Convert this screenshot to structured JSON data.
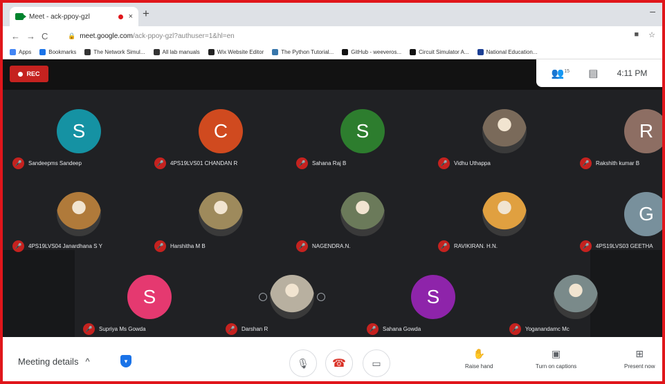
{
  "browser": {
    "tab_title": "Meet - ack-ppoy-gzl",
    "tab_close": "×",
    "new_tab": "+",
    "minimize": "–",
    "nav_back": "←",
    "nav_forward": "→",
    "nav_reload": "C",
    "url_host": "meet.google.com",
    "url_rest": "/ack-ppoy-gzl?authuser=1&hl=en",
    "bookmarks": [
      {
        "label": "Apps",
        "color": "#4285f4"
      },
      {
        "label": "Bookmarks",
        "color": "#1a73e8"
      },
      {
        "label": "The Network Simul...",
        "color": "#333333"
      },
      {
        "label": "All lab manuals",
        "color": "#333333"
      },
      {
        "label": "Wix Website Editor",
        "color": "#222222"
      },
      {
        "label": "The Python Tutorial...",
        "color": "#3776ab"
      },
      {
        "label": "GitHub - weeveros...",
        "color": "#111111"
      },
      {
        "label": "Circuit Simulator A...",
        "color": "#111111"
      },
      {
        "label": "National Education...",
        "color": "#1c3f94"
      }
    ]
  },
  "meet": {
    "rec_label": "REC",
    "time": "4:11 PM",
    "people_count": "15",
    "participants": [
      {
        "name": "Sandeepms Sandeep",
        "initial": "S",
        "color": "#1592a3"
      },
      {
        "name": "4PS19LVS01 CHANDAN R",
        "initial": "C",
        "color": "#d04a1f"
      },
      {
        "name": "Sahana Raj B",
        "initial": "S",
        "color": "#2d7d2e"
      },
      {
        "name": "Vidhu Uthappa",
        "initial": "",
        "color": "#7a6a5a"
      },
      {
        "name": "Rakshith kumar B",
        "initial": "R",
        "color": "#8d6e63"
      },
      {
        "name": "4PS19LVS04 Janardhana S Y",
        "initial": "",
        "color": "#b07a3a"
      },
      {
        "name": "Harshitha M B",
        "initial": "",
        "color": "#9e8a5c"
      },
      {
        "name": "NAGENDRA.N.",
        "initial": "",
        "color": "#6b7a5a"
      },
      {
        "name": "RAVIKIRAN. H.N.",
        "initial": "",
        "color": "#e0a040"
      },
      {
        "name": "4PS19LVS03 GEETHA",
        "initial": "G",
        "color": "#78909c"
      },
      {
        "name": "Supriya Ms Gowda",
        "initial": "S",
        "color": "#e53970"
      },
      {
        "name": "Darshan R",
        "initial": "",
        "color": "#b8b0a0"
      },
      {
        "name": "Sahana Gowda",
        "initial": "S",
        "color": "#8e24aa"
      },
      {
        "name": "Yoganandamc Mc",
        "initial": "",
        "color": "#7a8a8a"
      }
    ]
  },
  "bottom": {
    "meeting_details": "Meeting details",
    "chevron": "^",
    "actions": {
      "raise_hand": "Raise hand",
      "captions": "Turn on captions",
      "present": "Present now"
    }
  }
}
